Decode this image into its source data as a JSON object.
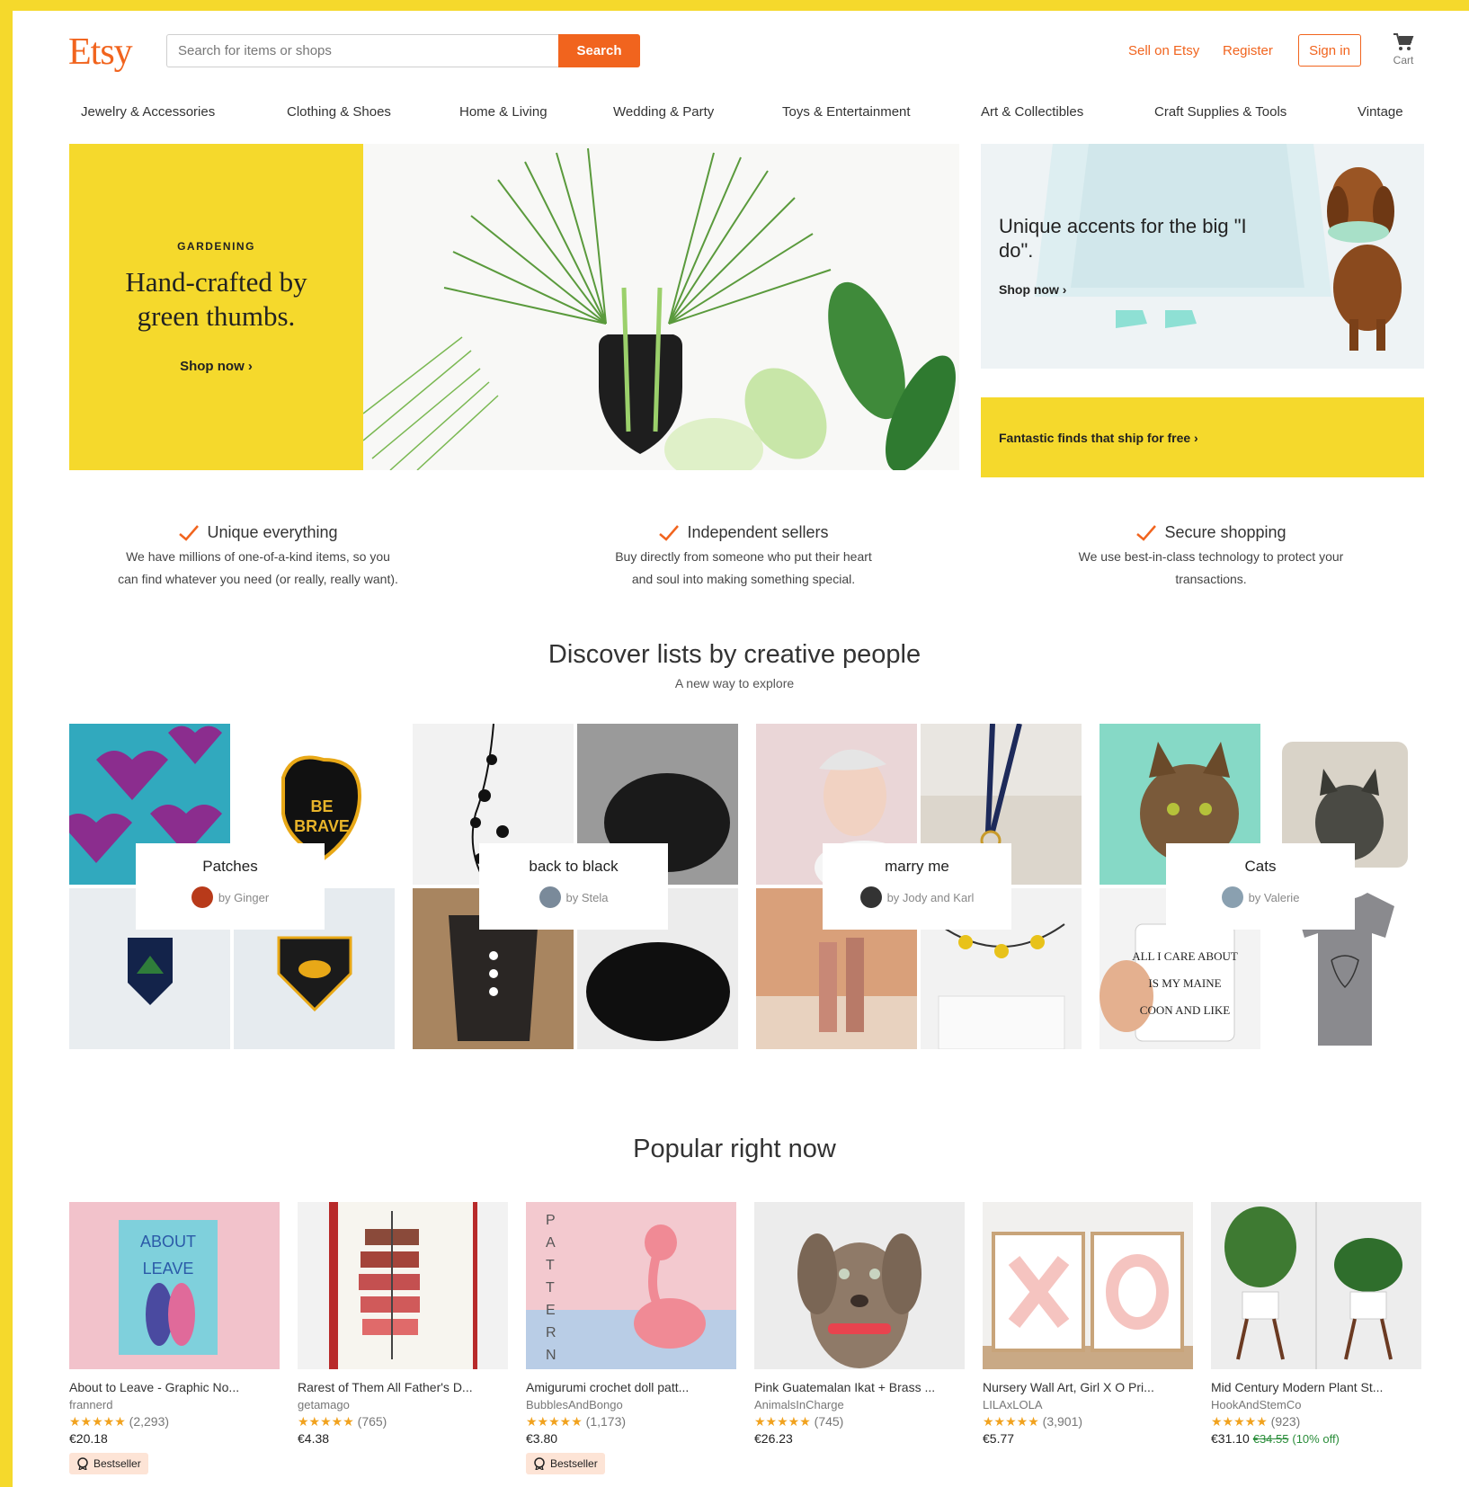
{
  "header": {
    "logo": "Etsy",
    "search_placeholder": "Search for items or shops",
    "search_button": "Search",
    "sell": "Sell on Etsy",
    "register": "Register",
    "signin": "Sign in",
    "cart": "Cart"
  },
  "categories": [
    "Jewelry & Accessories",
    "Clothing & Shoes",
    "Home & Living",
    "Wedding & Party",
    "Toys & Entertainment",
    "Art & Collectibles",
    "Craft Supplies & Tools",
    "Vintage"
  ],
  "hero": {
    "eyebrow": "GARDENING",
    "title": "Hand-crafted by green thumbs.",
    "cta": "Shop now  ›"
  },
  "side_promo": {
    "title": "Unique accents for the big \"I do\".",
    "cta": "Shop now  ›"
  },
  "free_shipping": "Fantastic finds that ship for free  ›",
  "value_props": [
    {
      "title": "Unique everything",
      "line1": "We have millions of one-of-a-kind items, so you",
      "line2": "can find whatever you need (or really, really want)."
    },
    {
      "title": "Independent sellers",
      "line1": "Buy directly from someone who put their heart",
      "line2": "and soul into making something special."
    },
    {
      "title": "Secure shopping",
      "line1": "We use best-in-class technology to protect your",
      "line2": "transactions."
    }
  ],
  "discover": {
    "title": "Discover lists by creative people",
    "subtitle": "A new way to explore",
    "lists": [
      {
        "name": "Patches",
        "by": "by Ginger"
      },
      {
        "name": "back to black",
        "by": "by Stela"
      },
      {
        "name": "marry me",
        "by": "by Jody and Karl"
      },
      {
        "name": "Cats",
        "by": "by Valerie"
      }
    ]
  },
  "popular": {
    "title": "Popular right now",
    "products": [
      {
        "title": "About to Leave - Graphic No...",
        "shop": "frannerd",
        "stars": "★★★★★",
        "reviews": "(2,293)",
        "price": "€20.18",
        "old_price": "",
        "discount": "",
        "badge": "Bestseller"
      },
      {
        "title": "Rarest of Them All Father's D...",
        "shop": "getamago",
        "stars": "★★★★★",
        "reviews": "(765)",
        "price": "€4.38",
        "old_price": "",
        "discount": "",
        "badge": ""
      },
      {
        "title": "Amigurumi crochet doll patt...",
        "shop": "BubblesAndBongo",
        "stars": "★★★★★",
        "reviews": "(1,173)",
        "price": "€3.80",
        "old_price": "",
        "discount": "",
        "badge": "Bestseller"
      },
      {
        "title": "Pink Guatemalan Ikat + Brass ...",
        "shop": "AnimalsInCharge",
        "stars": "★★★★★",
        "reviews": "(745)",
        "price": "€26.23",
        "old_price": "",
        "discount": "",
        "badge": ""
      },
      {
        "title": "Nursery Wall Art, Girl X O Pri...",
        "shop": "LILAxLOLA",
        "stars": "★★★★★",
        "reviews": "(3,901)",
        "price": "€5.77",
        "old_price": "",
        "discount": "",
        "badge": ""
      },
      {
        "title": "Mid Century Modern Plant St...",
        "shop": "HookAndStemCo",
        "stars": "★★★★★",
        "reviews": "(923)",
        "price": "€31.10",
        "old_price": "€34.55",
        "discount": "(10% off)",
        "badge": ""
      }
    ]
  },
  "colors": {
    "brand": "#f1641e",
    "yellow": "#f5d92c",
    "star": "#f1a21e"
  }
}
